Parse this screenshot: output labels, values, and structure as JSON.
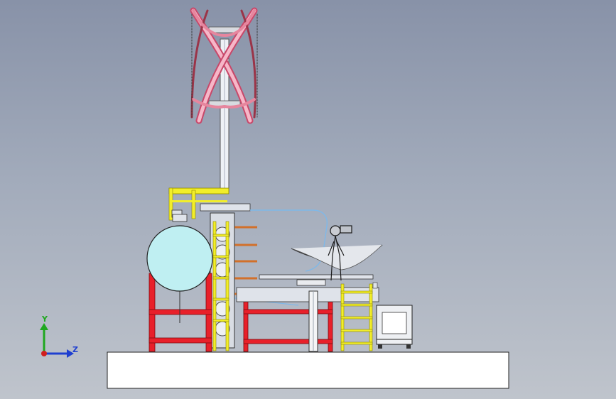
{
  "view": {
    "background_top": "#8892a8",
    "background_bottom": "#bfc4cc"
  },
  "triad": {
    "y_label": "Y",
    "z_label": "Z",
    "y_color": "#1fa81f",
    "z_color": "#1f3fd0",
    "origin_color": "#d01f1f"
  },
  "model": {
    "components": [
      "vertical-axis-wind-turbine",
      "mast",
      "spherical-tank",
      "steel-frame",
      "ladder",
      "operator-figure",
      "trough-collector",
      "electrical-cabinet",
      "base-plate"
    ],
    "colors": {
      "frame": "#e8202a",
      "ladder": "#f2ee2a",
      "tank": "#bfeff2",
      "turbine_blade": "#e85a80",
      "pipe": "#d2702a"
    }
  }
}
